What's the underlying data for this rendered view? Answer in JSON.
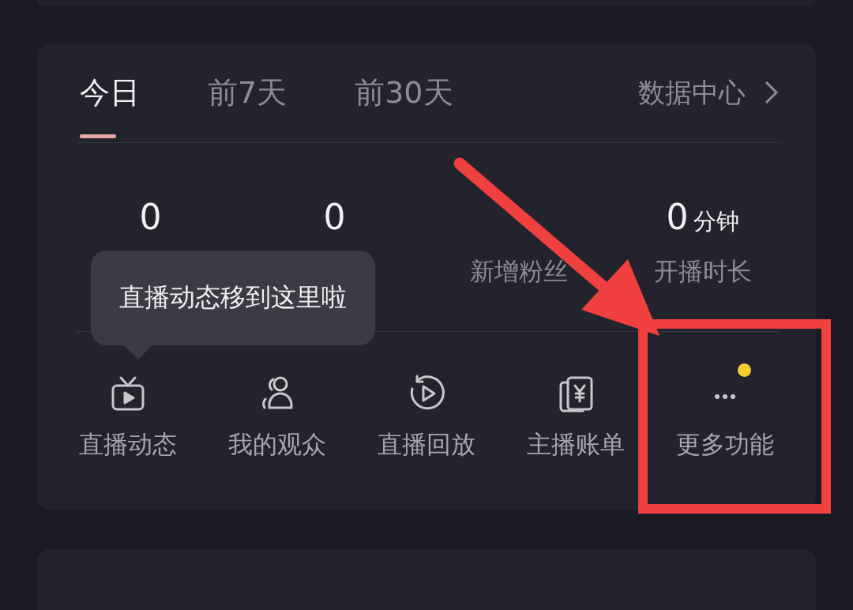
{
  "tabs": [
    {
      "label": "今日",
      "selected": true
    },
    {
      "label": "前7天",
      "selected": false
    },
    {
      "label": "前30天",
      "selected": false
    }
  ],
  "data_center_link": {
    "label": "数据中心"
  },
  "stats": [
    {
      "value": "0"
    },
    {
      "value": "0"
    },
    {
      "label": "新增粉丝"
    },
    {
      "value": "0",
      "unit": "分钟",
      "label": "开播时长"
    }
  ],
  "tooltip": {
    "text": "直播动态移到这里啦"
  },
  "shortcuts": [
    {
      "kind": "tv",
      "label": "直播动态",
      "badge": false
    },
    {
      "kind": "audience",
      "label": "我的观众",
      "badge": false
    },
    {
      "kind": "replay",
      "label": "直播回放",
      "badge": false
    },
    {
      "kind": "bill",
      "label": "主播账单",
      "badge": false
    },
    {
      "kind": "more",
      "label": "更多功能",
      "badge": true
    }
  ],
  "annotations": [
    {
      "kind": "arrow"
    },
    {
      "kind": "frame"
    }
  ]
}
